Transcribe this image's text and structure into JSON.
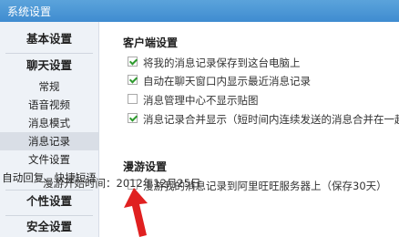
{
  "window": {
    "title": "系统设置"
  },
  "sidebar": {
    "sections": [
      {
        "label": "基本设置"
      },
      {
        "label": "聊天设置"
      },
      {
        "label": "个性设置"
      },
      {
        "label": "安全设置"
      }
    ],
    "chat_items": [
      {
        "label": "常规"
      },
      {
        "label": "语音视频"
      },
      {
        "label": "消息模式"
      },
      {
        "label": "消息记录",
        "active": true
      },
      {
        "label": "文件设置"
      },
      {
        "label": "自动回复、快捷短语"
      }
    ]
  },
  "client": {
    "title": "客户端设置",
    "options": [
      {
        "label": "将我的消息记录保存到这台电脑上",
        "checked": true
      },
      {
        "label": "自动在聊天窗口内显示最近消息记录",
        "checked": true
      },
      {
        "label": "消息管理中心不显示贴图",
        "checked": false
      },
      {
        "label": "消息记录合并显示（短时间内连续发送的消息合并在一起）",
        "checked": true
      }
    ]
  },
  "roaming": {
    "title": "漫游设置",
    "option": {
      "label": "漫游我的消息记录到阿里旺旺服务器上（保存30天）",
      "checked": false
    },
    "start_time": "漫游开始时间：2012年12月25日"
  },
  "colors": {
    "titlebar": "#4a97d6",
    "arrow": "#e02020",
    "checkmark": "#2e9a2e"
  }
}
